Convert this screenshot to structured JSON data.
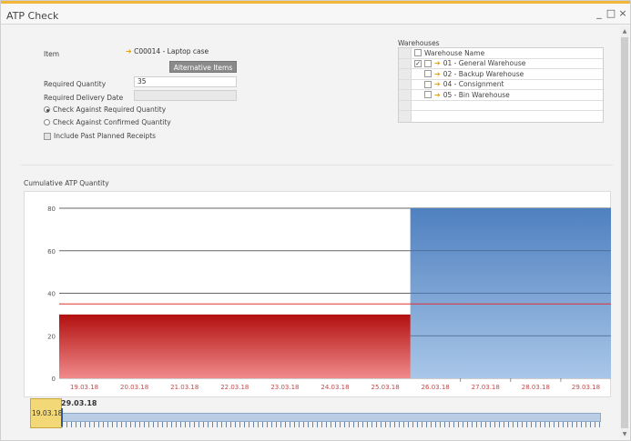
{
  "window": {
    "title": "ATP Check",
    "minimize_glyph": "_",
    "maximize_glyph": "□",
    "close_glyph": "×"
  },
  "form": {
    "item_label": "Item",
    "item_value": "C00014 - Laptop case",
    "alternative_items_label": "Alternative Items",
    "required_quantity_label": "Required Quantity",
    "required_quantity_value": "35",
    "required_delivery_date_label": "Required Delivery Date",
    "required_delivery_date_value": "",
    "option_required_label": "Check Against Required Quantity",
    "option_required_selected": true,
    "option_confirmed_label": "Check Against Confirmed Quantity",
    "option_confirmed_selected": false,
    "include_past_label": "Include Past Planned Receipts",
    "include_past_checked": false
  },
  "warehouses": {
    "title": "Warehouses",
    "header": "Warehouse Name",
    "rows": [
      {
        "name": "01 - General Warehouse",
        "checked": true
      },
      {
        "name": "02 - Backup Warehouse",
        "checked": false
      },
      {
        "name": "04 - Consignment",
        "checked": false
      },
      {
        "name": "05 - Bin Warehouse",
        "checked": false
      }
    ],
    "check_glyph": "✓"
  },
  "chart_title": "Cumulative ATP Quantity",
  "chart_data": {
    "type": "bar",
    "title": "Cumulative ATP Quantity",
    "categories": [
      "19.03.18",
      "20.03.18",
      "21.03.18",
      "22.03.18",
      "23.03.18",
      "24.03.18",
      "25.03.18",
      "26.03.18",
      "27.03.18",
      "28.03.18",
      "29.03.18"
    ],
    "series": [
      {
        "values": [
          30,
          30,
          30,
          30,
          30,
          30,
          30,
          80,
          80,
          80,
          80
        ]
      }
    ],
    "required_quantity_line": 35,
    "yticks": [
      0,
      20,
      40,
      60,
      80
    ],
    "ylim": [
      0,
      80
    ],
    "colors": {
      "shortfall": "#c81414",
      "available": "#6f9ad3",
      "required_line": "#e03030",
      "axis": "#555555"
    },
    "grid": true
  },
  "timeline": {
    "top_date": "29.03.18",
    "left_date": "19.03.18",
    "marker_color": "#2f5aa0"
  }
}
